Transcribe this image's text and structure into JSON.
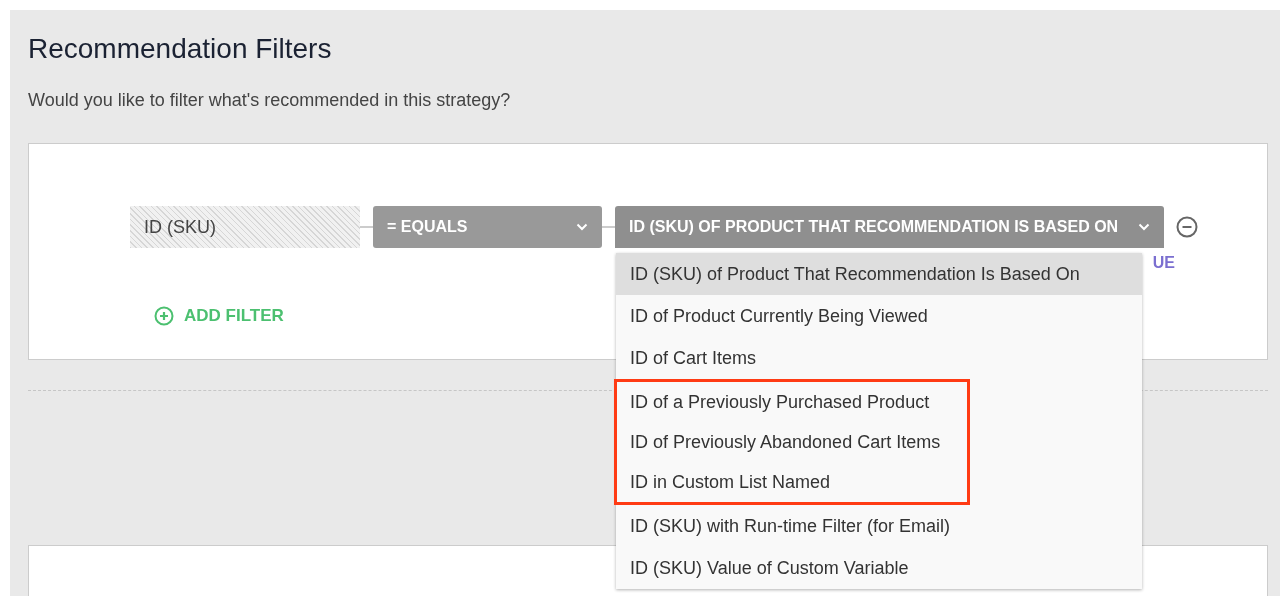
{
  "title": "Recommendation Filters",
  "subtitle": "Would you like to filter what's recommended in this strategy?",
  "filters": [
    {
      "field": "ID (SKU)",
      "operator": "= EQUALS",
      "value": "ID (SKU) OF PRODUCT THAT RECOMMENDATION IS BASED ON",
      "value_hint": "UE",
      "expanded": true,
      "options": [
        {
          "label": "ID (SKU) of Product That Recommendation Is Based On",
          "selected": true,
          "highlighted": false
        },
        {
          "label": "ID of Product Currently Being Viewed",
          "selected": false,
          "highlighted": false
        },
        {
          "label": "ID of Cart Items",
          "selected": false,
          "highlighted": false
        },
        {
          "label": "ID of a Previously Purchased Product",
          "selected": false,
          "highlighted": true
        },
        {
          "label": "ID of Previously Abandoned Cart Items",
          "selected": false,
          "highlighted": true
        },
        {
          "label": "ID in Custom List Named",
          "selected": false,
          "highlighted": true
        },
        {
          "label": "ID (SKU) with Run-time Filter (for Email)",
          "selected": false,
          "highlighted": false
        },
        {
          "label": "ID (SKU) Value of Custom Variable",
          "selected": false,
          "highlighted": false
        }
      ]
    }
  ],
  "add_filter": "ADD FILTER"
}
